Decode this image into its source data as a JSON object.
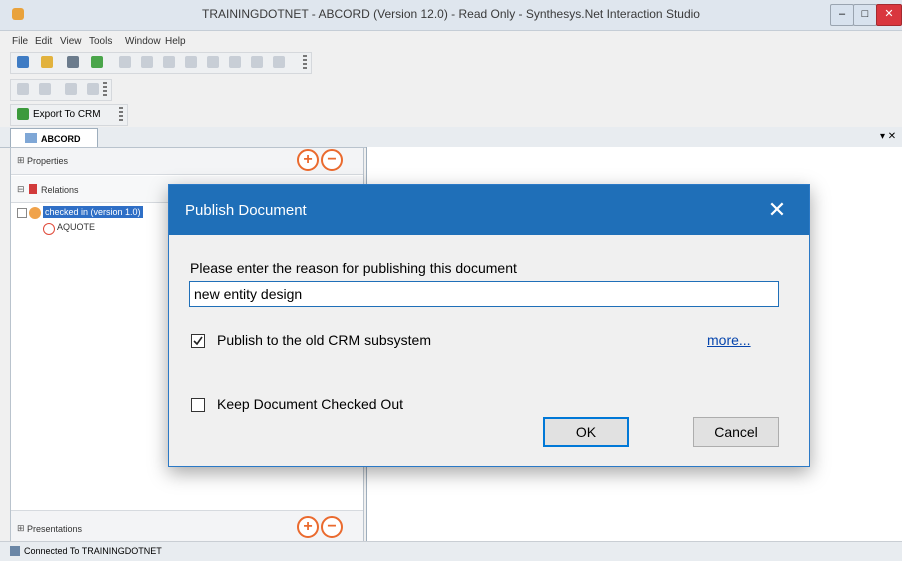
{
  "window": {
    "title": "TRAININGDOTNET - ABCORD (Version 12.0) - Read Only - Synthesys.Net Interaction Studio",
    "min": "–",
    "max": "□",
    "close": "✕"
  },
  "menubar": [
    "File",
    "Edit",
    "View",
    "Tools",
    "Window",
    "Help"
  ],
  "toolbar3": {
    "export_label": "Export To CRM"
  },
  "tab": {
    "label": "ABCORD",
    "pin": "▾ ✕"
  },
  "left": {
    "properties": "Properties",
    "relations": "Relations",
    "tree": {
      "node_label": "checked in (version 1.0)",
      "child_label": "AQUOTE"
    },
    "presentations": "Presentations",
    "plus": "+",
    "minus": "−",
    "expand": "⊞",
    "collapse": "⊟"
  },
  "status": {
    "text": "Connected To TRAININGDOTNET"
  },
  "dialog": {
    "title": "Publish Document",
    "close": "✕",
    "prompt": "Please enter the reason for publishing this document",
    "reason_value": "new entity design",
    "publish_old_label": "Publish to the old CRM subsystem",
    "publish_old_checked": true,
    "more_link": "more...",
    "keep_checked_out_label": "Keep Document Checked Out",
    "keep_checked_out_checked": false,
    "ok": "OK",
    "cancel": "Cancel"
  }
}
